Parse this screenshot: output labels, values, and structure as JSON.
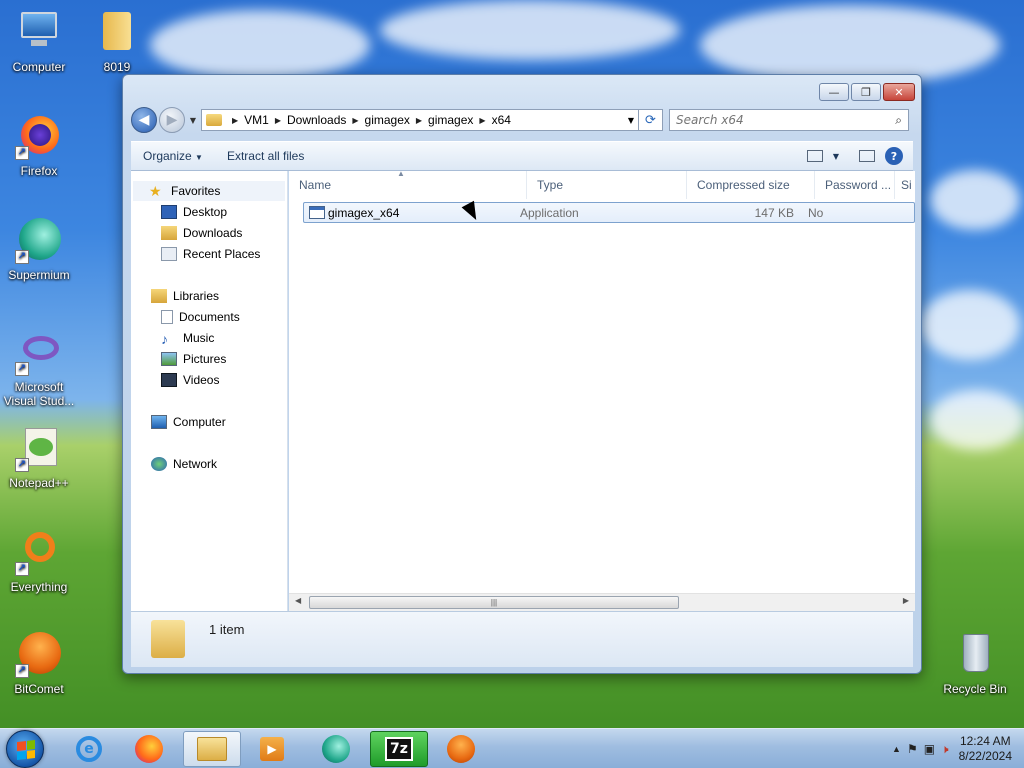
{
  "desktop": {
    "icons_left": [
      {
        "label": "Computer",
        "icon": "computer-icon"
      },
      {
        "label": "Firefox",
        "icon": "firefox-icon"
      },
      {
        "label": "Supermium",
        "icon": "supermium-icon"
      },
      {
        "label": "Microsoft Visual Stud...",
        "icon": "visual-studio-icon"
      },
      {
        "label": "Notepad++",
        "icon": "notepadpp-icon"
      },
      {
        "label": "Everything",
        "icon": "everything-icon"
      },
      {
        "label": "BitComet",
        "icon": "bitcomet-icon"
      }
    ],
    "folder_8019": {
      "label": "8019",
      "icon": "folder-icon"
    },
    "recycle_bin": {
      "label": "Recycle Bin",
      "icon": "recycle-bin-icon"
    }
  },
  "window": {
    "controls": {
      "minimize": "—",
      "maximize": "❐",
      "close": "✕"
    },
    "address": {
      "crumbs": [
        "VM1",
        "Downloads",
        "gimagex",
        "gimagex",
        "x64"
      ]
    },
    "search": {
      "placeholder": "Search x64"
    },
    "toolbar": {
      "organize": "Organize",
      "extract": "Extract all files"
    },
    "navpane": {
      "favorites": "Favorites",
      "desktop": "Desktop",
      "downloads": "Downloads",
      "recent": "Recent Places",
      "libraries": "Libraries",
      "documents": "Documents",
      "music": "Music",
      "pictures": "Pictures",
      "videos": "Videos",
      "computer": "Computer",
      "network": "Network"
    },
    "columns": {
      "name": "Name",
      "type": "Type",
      "compressed": "Compressed size",
      "password": "Password ...",
      "size": "Si"
    },
    "files": [
      {
        "name": "gimagex_x64",
        "type": "Application",
        "compressed_size": "147 KB",
        "password": "No"
      }
    ],
    "details": {
      "count": "1 item"
    }
  },
  "taskbar": {
    "clock_time": "12:24 AM",
    "clock_date": "8/22/2024"
  },
  "colors": {
    "accent": "#2a61b5",
    "selection_border": "#7da2ce"
  }
}
